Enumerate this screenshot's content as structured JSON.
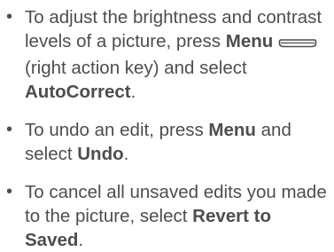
{
  "bullet_char": "•",
  "items": [
    {
      "pre": "To adjust the brightness and contrast levels of a picture, press ",
      "key1": "Menu",
      "mid": "(right action key) and select ",
      "key2": "AutoCorrect",
      "end": "."
    },
    {
      "pre": "To undo an edit, press ",
      "key1": "Menu",
      "mid": " and select ",
      "key2": "Undo",
      "end": "."
    },
    {
      "pre": "To cancel all unsaved edits you made to the picture, select ",
      "key1": "Revert to Saved",
      "end": "."
    }
  ],
  "icons": {
    "menu_key": "menu-key-icon"
  }
}
